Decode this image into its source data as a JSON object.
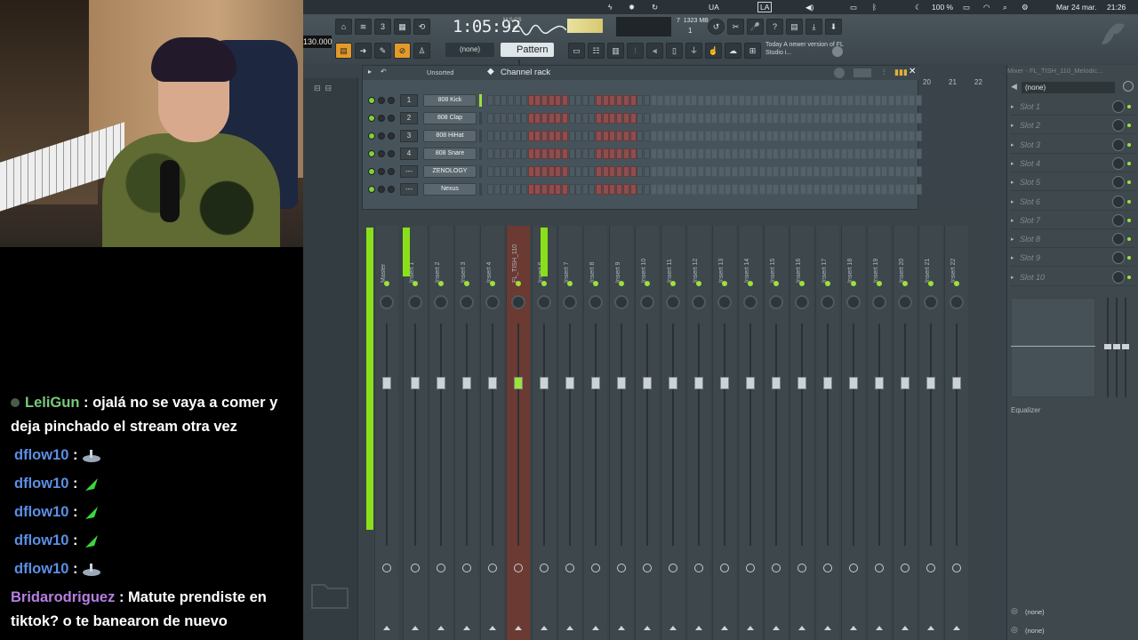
{
  "chat": {
    "messages": [
      {
        "user": "LeliGun",
        "user_color": "#78c97d",
        "text": "ojalá no se vaya a comer y deja pinchado el stream otra vez",
        "emote": ""
      },
      {
        "user": "dflow10",
        "user_color": "#5b8fe6",
        "text": "",
        "emote": "dish-emote"
      },
      {
        "user": "dflow10",
        "user_color": "#5b8fe6",
        "text": "",
        "emote": "leaf-emote"
      },
      {
        "user": "dflow10",
        "user_color": "#5b8fe6",
        "text": "",
        "emote": "leaf-emote"
      },
      {
        "user": "dflow10",
        "user_color": "#5b8fe6",
        "text": "",
        "emote": "leaf-emote"
      },
      {
        "user": "dflow10",
        "user_color": "#5b8fe6",
        "text": "",
        "emote": "dish-emote"
      },
      {
        "user": "Bridarodriguez",
        "user_color": "#b67fe2",
        "text": "Matute prendiste en tiktok? o te banearon de nuevo",
        "emote": ""
      }
    ]
  },
  "menubar": {
    "lang": "UA",
    "la": "LA",
    "battery": "100 %",
    "date": "Mar 24 mar.",
    "time": "21:26"
  },
  "toolbar": {
    "tempo": "130.000",
    "timecode": "1:05:92",
    "timecode_unit": "M:S:CS",
    "memory": "1323 MB",
    "cpu": "7",
    "voices": "1",
    "pattern": "Pattern 1",
    "none_selector": "(none)",
    "news": "Today  A newer version of FL Studio i..."
  },
  "channel_rack": {
    "title": "Channel rack",
    "sort": "Unsorted",
    "channels": [
      {
        "num": "1",
        "name": "808 Kick"
      },
      {
        "num": "2",
        "name": "808 Clap"
      },
      {
        "num": "3",
        "name": "808 HiHat"
      },
      {
        "num": "4",
        "name": "808 Snare"
      },
      {
        "num": "---",
        "name": "ZENOLOGY"
      },
      {
        "num": "---",
        "name": "Nexus"
      }
    ],
    "add": "+"
  },
  "mixer": {
    "title": "Mixer - FL_TISH_110_Melodic...",
    "strips": [
      "Master",
      "Insert 1",
      "Insert 2",
      "Insert 3",
      "Insert 4",
      "FL_TISH_110",
      "Insert 6",
      "Insert 7",
      "Insert 8",
      "Insert 9",
      "Insert 10",
      "Insert 11",
      "Insert 12",
      "Insert 13",
      "Insert 14",
      "Insert 15",
      "Insert 16",
      "Insert 17",
      "Insert 18",
      "Insert 19",
      "Insert 20",
      "Insert 21",
      "Insert 22"
    ],
    "col_numbers": [
      "20",
      "21",
      "22"
    ],
    "selected": "FL_TISH_110",
    "accent": "#9be23a"
  },
  "mixer_panel": {
    "preset": "(none)",
    "slots": [
      "Slot 1",
      "Slot 2",
      "Slot 3",
      "Slot 4",
      "Slot 5",
      "Slot 6",
      "Slot 7",
      "Slot 8",
      "Slot 9",
      "Slot 10"
    ],
    "eq_label": "Equalizer",
    "out_1": "(none)",
    "out_2": "(none)"
  }
}
